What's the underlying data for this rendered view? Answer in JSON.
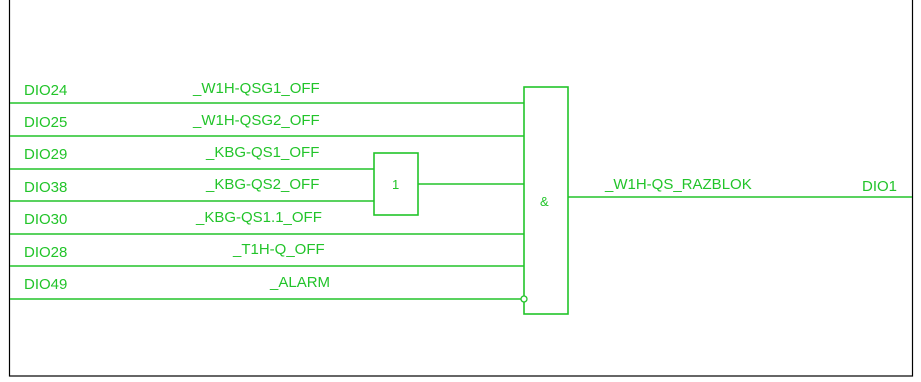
{
  "signals": [
    {
      "port": "DIO24",
      "name": "_W1H-QSG1_OFF"
    },
    {
      "port": "DIO25",
      "name": "_W1H-QSG2_OFF"
    },
    {
      "port": "DIO29",
      "name": "_KBG-QS1_OFF"
    },
    {
      "port": "DIO38",
      "name": "_KBG-QS2_OFF"
    },
    {
      "port": "DIO30",
      "name": "_KBG-QS1.1_OFF"
    },
    {
      "port": "DIO28",
      "name": "_T1H-Q_OFF"
    },
    {
      "port": "DIO49",
      "name": "_ALARM"
    }
  ],
  "or_gate": {
    "symbol": "1"
  },
  "and_gate": {
    "symbol": "&"
  },
  "output": {
    "name": "_W1H-QS_RAZBLOK",
    "port": "DIO1"
  },
  "colors": {
    "wire": "#22c42a",
    "frame": "#000000"
  }
}
